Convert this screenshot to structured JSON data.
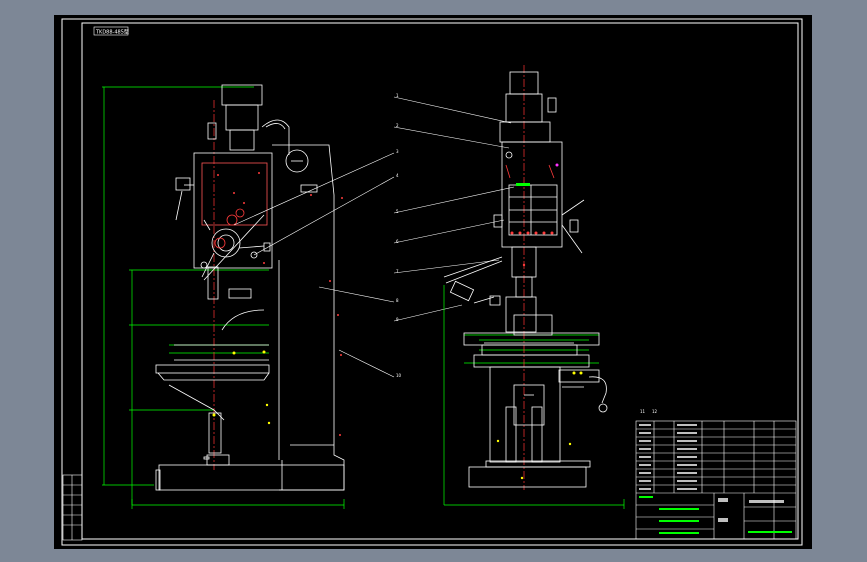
{
  "title_tag": {
    "text": "TKD88-485型"
  },
  "leader_numbers": [
    "1",
    "2",
    "3",
    "4",
    "5",
    "6",
    "7",
    "8",
    "9",
    "10",
    "11",
    "12"
  ],
  "colors": {
    "background_outer": "#7d8796",
    "sheet": "#000000",
    "frame": "#ffffff",
    "dimension": "#00ff00",
    "centerline": "#ff3333",
    "machine_outline": "#ffffff",
    "accent_red": "#ff3b3b",
    "accent_yellow": "#ffff00",
    "accent_magenta": "#ff33ff"
  },
  "icons": [
    "drill-press-front-view",
    "drill-press-side-view",
    "title-block"
  ]
}
